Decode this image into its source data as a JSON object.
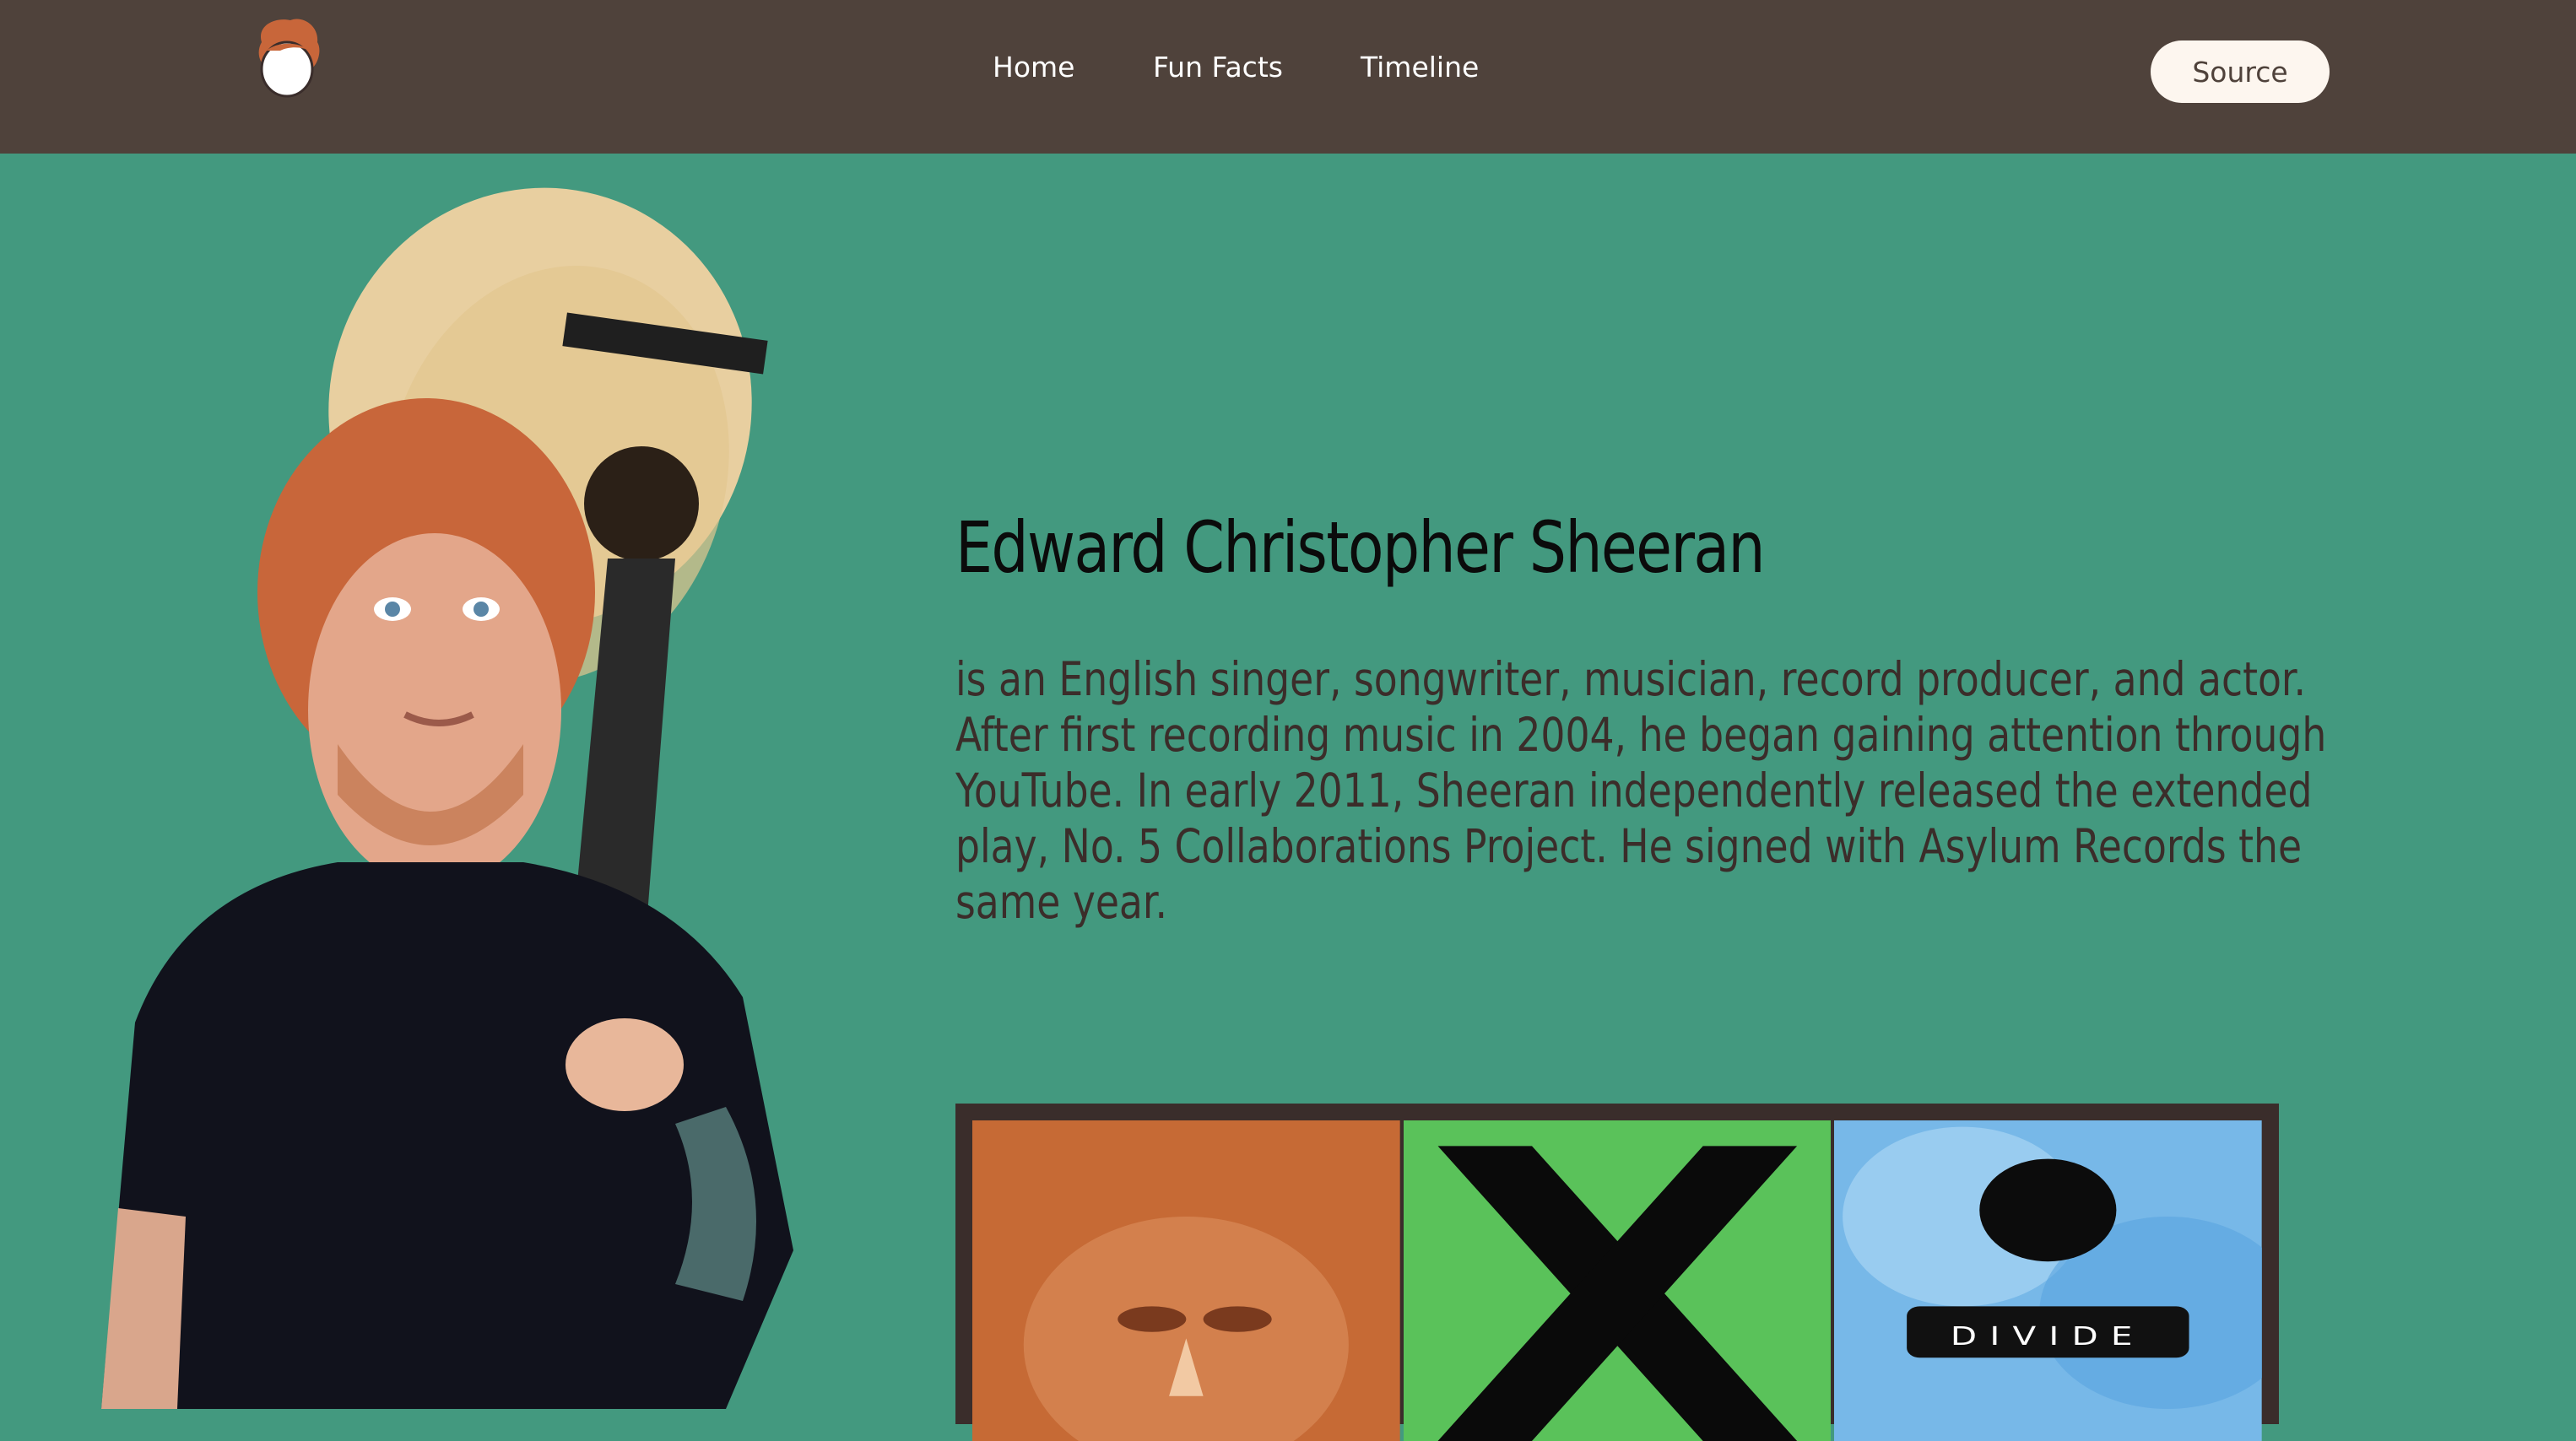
{
  "nav": {
    "links": [
      "Home",
      "Fun Facts",
      "Timeline"
    ],
    "source_label": "Source"
  },
  "hero": {
    "name": "Edward Christopher Sheeran",
    "bio": "is an English singer, songwriter, musician, record producer, and actor. After first recording music in 2004, he began gaining attention through YouTube. In early 2011, Sheeran independently released the extended play, No. 5 Collaborations Project. He signed with Asylum Records the same year."
  },
  "albums": {
    "divide_label": "DIVIDE"
  },
  "colors": {
    "navbar": "#4f423b",
    "page_bg": "#43997f",
    "button_bg": "#fdf6ef",
    "album_frame": "#3a2d2b"
  }
}
